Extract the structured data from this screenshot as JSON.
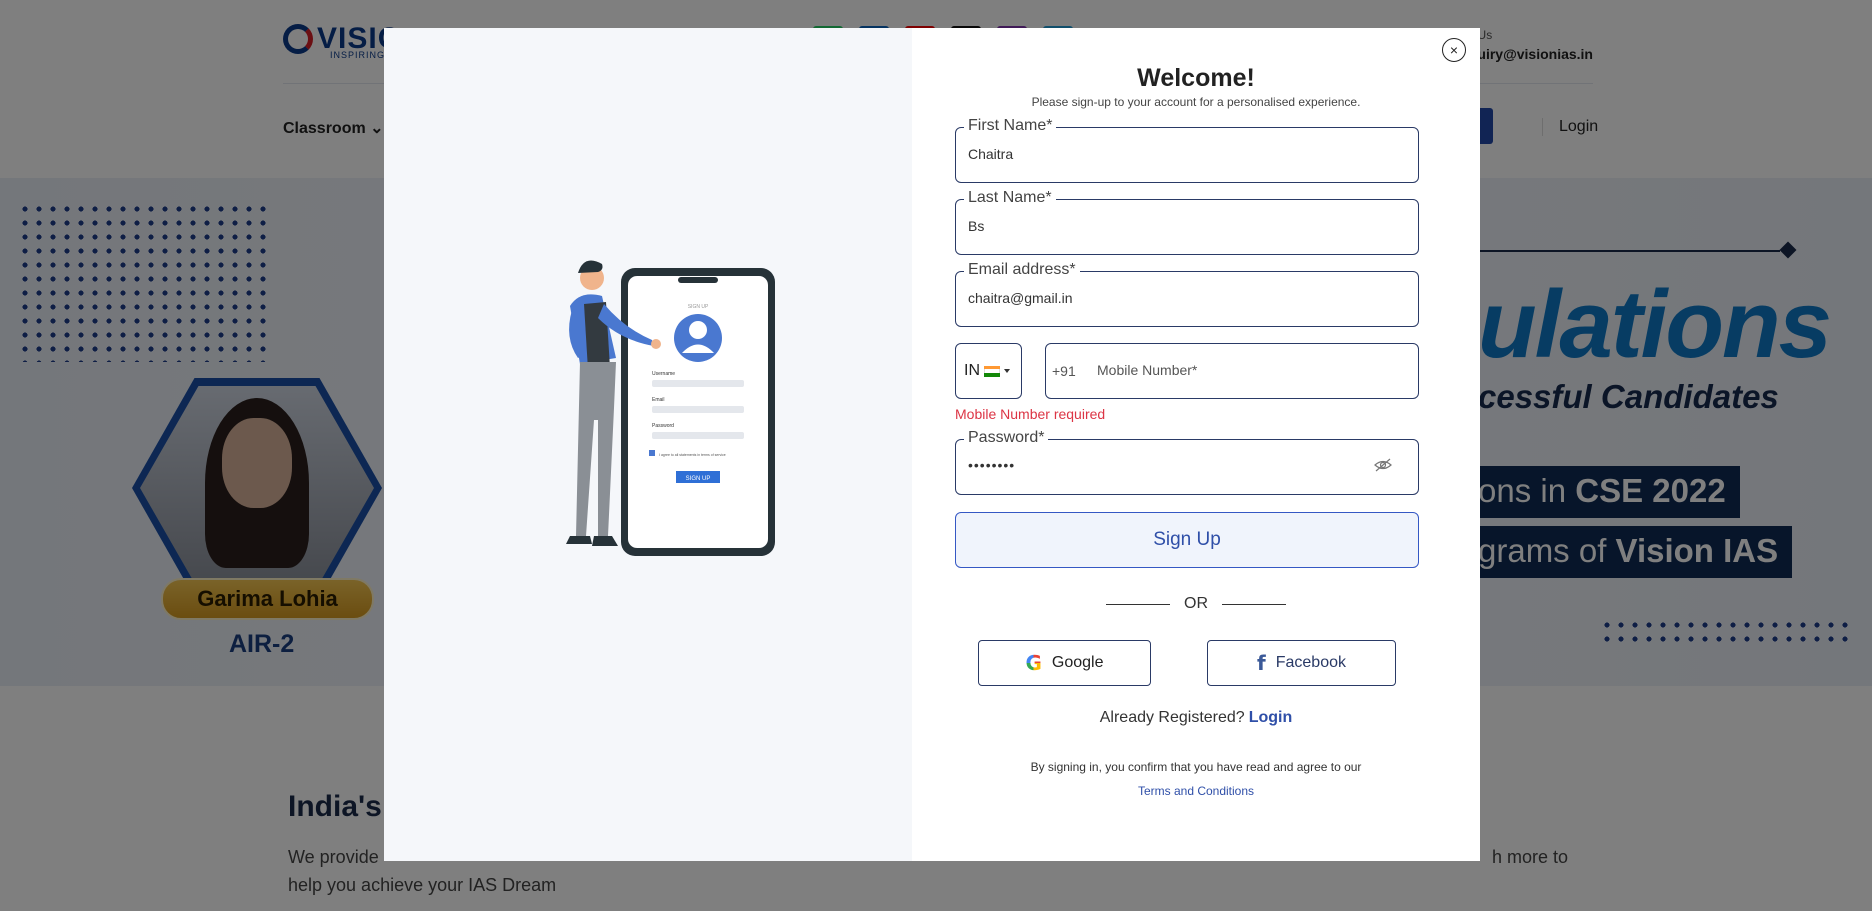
{
  "background": {
    "logo_text": "VISIO",
    "logo_sub": "INSPIRING",
    "mail_label": "il Us",
    "mail_value": "quiry@visionias.in",
    "nav_classroom": "Classroom",
    "nav_login": "Login",
    "hero_big": "ulations",
    "hero_sub": "cessful Candidates",
    "hero_strip_1_pre": "ons in ",
    "hero_strip_1_bold": "CSE 2022",
    "hero_strip_2_pre": "grams of ",
    "hero_strip_2_bold": "Vision IAS",
    "topper_name": "Garima Lohia",
    "topper_rank": "AIR-2",
    "section_title": "India's",
    "section_text_1": "We provide",
    "section_text_1_end": "h more to",
    "section_text_2": "help you achieve your IAS Dream"
  },
  "modal": {
    "close_symbol": "×",
    "title": "Welcome!",
    "subtitle": "Please sign-up to your account for a personalised experience.",
    "first_name": {
      "label": "First Name*",
      "value": "Chaitra"
    },
    "last_name": {
      "label": "Last Name*",
      "value": "Bs"
    },
    "email": {
      "label": "Email address*",
      "value": "chaitra@gmail.in"
    },
    "country": {
      "code": "IN"
    },
    "phone": {
      "dial_code": "+91",
      "placeholder": "Mobile Number*",
      "error": "Mobile Number required"
    },
    "password": {
      "label": "Password*",
      "value": "••••••••"
    },
    "signup_button": "Sign Up",
    "or_text": "OR",
    "google_button": "Google",
    "google_icon": "G",
    "facebook_button": "Facebook",
    "facebook_icon": "f",
    "already_registered": "Already Registered?",
    "login_link": "Login",
    "terms_text": "By signing in, you confirm that you have read and agree to our",
    "terms_link": "Terms and Conditions",
    "illustration": {
      "phone_header": "SIGN UP",
      "username_label": "Username",
      "email_label": "Email",
      "password_label": "Password",
      "agree_text": "I agree to all statements in terms of service",
      "signup_label": "SIGN UP"
    }
  },
  "colors": {
    "accent": "#2f4fa8",
    "error": "#dc3545",
    "border": "#2a3a66",
    "overlay": "rgba(0,0,0,0.5)"
  }
}
